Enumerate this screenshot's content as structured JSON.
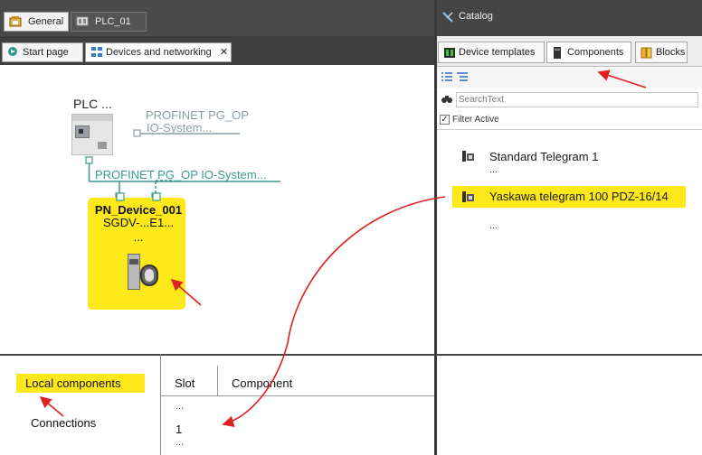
{
  "tabs": {
    "general": "General",
    "plc": "PLC_01",
    "start_page": "Start page",
    "devices_networking": "Devices and networking",
    "close": "✕"
  },
  "diagram": {
    "plc_label": "PLC ...",
    "pg_op_label_1": "PROFINET PG_OP",
    "pg_op_label_2": "IO-System...",
    "pg_op_line_label": "PROFINET PG_OP IO-System...",
    "device_name": "PN_Device_001",
    "device_type": "SGDV-...E1...",
    "device_more": "...",
    "highlight_color": "#ffe81a",
    "network_color": "#3a9a8c"
  },
  "catalog": {
    "title": "Catalog",
    "tab_device_templates": "Device templates",
    "tab_components": "Components",
    "tab_blocks": "Blocks",
    "search_placeholder": "SearchText",
    "filter_label": "Filter Active",
    "items": [
      {
        "label": "Standard Telegram 1",
        "sub": "..."
      },
      {
        "label": "Yaskawa telegram 100 PDZ-16/14",
        "sub": "..."
      }
    ]
  },
  "bottom": {
    "local_components": "Local components",
    "connections": "Connections",
    "col_slot": "Slot",
    "col_component": "Component",
    "rows": [
      "...",
      "1",
      "..."
    ]
  },
  "annotation_color": "#e02020"
}
